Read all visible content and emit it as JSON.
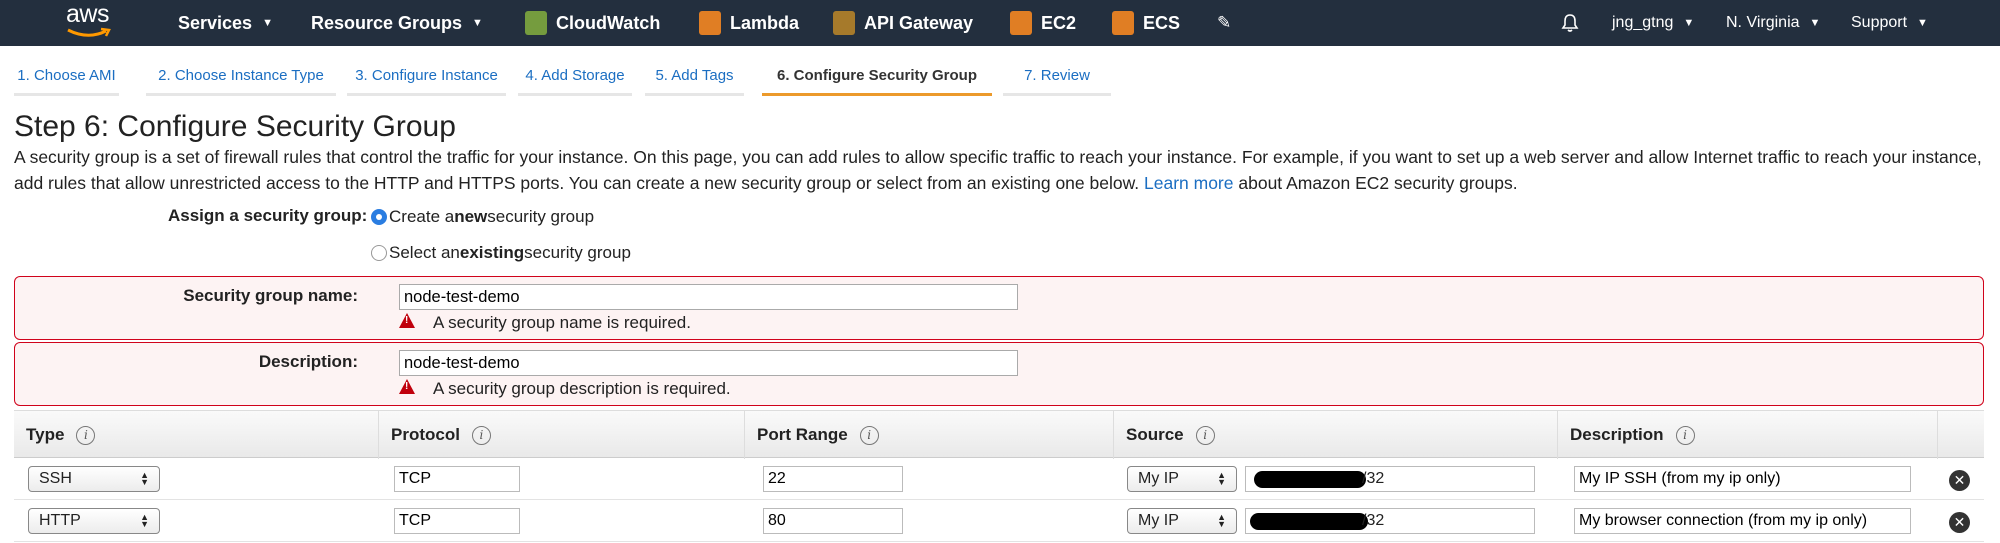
{
  "nav": {
    "logo_text": "aws",
    "services": "Services",
    "resource_groups": "Resource Groups",
    "cloudwatch": "CloudWatch",
    "lambda": "Lambda",
    "api_gateway": "API Gateway",
    "ec2": "EC2",
    "ecs": "ECS",
    "user": "jng_gtng",
    "region": "N. Virginia",
    "support": "Support"
  },
  "tabs": [
    {
      "label": "1. Choose AMI"
    },
    {
      "label": "2. Choose Instance Type"
    },
    {
      "label": "3. Configure Instance"
    },
    {
      "label": "4. Add Storage"
    },
    {
      "label": "5. Add Tags"
    },
    {
      "label": "6. Configure Security Group"
    },
    {
      "label": "7. Review"
    }
  ],
  "step_title": "Step 6: Configure Security Group",
  "intro": {
    "text": "A security group is a set of firewall rules that control the traffic for your instance. On this page, you can add rules to allow specific traffic to reach your instance. For example, if you want to set up a web server and allow Internet traffic to reach your instance, add rules that allow unrestricted access to the HTTP and HTTPS ports. You can create a new security group or select from an existing one below.",
    "link": "Learn more",
    "suffix": "about Amazon EC2 security groups."
  },
  "assign": {
    "label": "Assign a security group:",
    "option_new_pre": "Create a ",
    "option_new_bold": "new",
    "option_new_post": " security group",
    "option_existing_pre": "Select an ",
    "option_existing_bold": "existing",
    "option_existing_post": " security group",
    "selected": "new"
  },
  "group_name": {
    "label": "Security group name:",
    "value": "node-test-demo",
    "error": "A security group name is required."
  },
  "description": {
    "label": "Description:",
    "value": "node-test-demo",
    "error": "A security group description is required."
  },
  "table": {
    "headers": {
      "type": "Type",
      "protocol": "Protocol",
      "port_range": "Port Range",
      "source": "Source",
      "description": "Description"
    },
    "rows": [
      {
        "type": "SSH",
        "protocol": "TCP",
        "port": "22",
        "source": "My IP",
        "ip_suffix": "/32",
        "description": "My IP SSH (from my ip only)"
      },
      {
        "type": "HTTP",
        "protocol": "TCP",
        "port": "80",
        "source": "My IP",
        "ip_suffix": "/32",
        "description": "My browser connection (from my ip only)"
      }
    ]
  },
  "colors": {
    "nav_bg": "#232f3e",
    "active_tab": "#ec9a2b",
    "link": "#1b6ec2",
    "error_border": "#d0021b"
  }
}
